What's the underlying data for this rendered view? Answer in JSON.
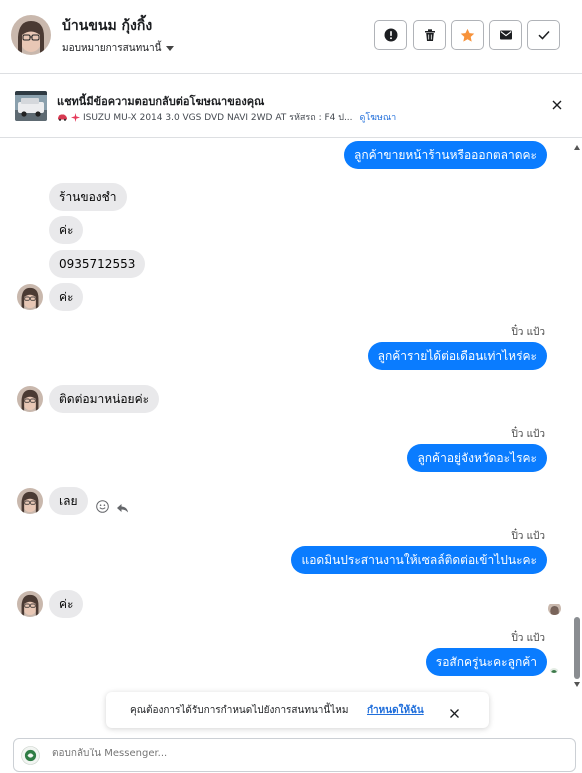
{
  "header": {
    "contact_name": "บ้านขนม กุ้งกิ้ง",
    "assign_label": "มอบหมายการสนทนานี้",
    "actions": [
      {
        "name": "mark-spam-button",
        "icon": "exclamation-icon"
      },
      {
        "name": "delete-button",
        "icon": "trash-icon"
      },
      {
        "name": "star-button",
        "icon": "star-icon"
      },
      {
        "name": "mark-unread-button",
        "icon": "envelope-icon"
      },
      {
        "name": "mark-done-button",
        "icon": "check-icon"
      }
    ],
    "star_color": "#f7923a"
  },
  "ad_banner": {
    "title": "แชทนี้มีข้อความตอบกลับต่อโฆษณาของคุณ",
    "subtitle": "ISUZU MU-X 2014 3.0 VGS DVD NAVI 2WD AT รหัสรถ : F4 ป...",
    "link_label": "ดูโฆษณา"
  },
  "messages": [
    {
      "dir": "out",
      "text": "ลูกค้าขายหน้าร้านหรือออกตลาดคะ"
    },
    {
      "dir": "in",
      "text": "ร้านของชำ"
    },
    {
      "dir": "in",
      "text": "ค่ะ"
    },
    {
      "dir": "in",
      "text": "0935712553"
    },
    {
      "dir": "in",
      "text": "ค่ะ"
    },
    {
      "dir": "out",
      "sender": "ปิ๋ว แป้ว",
      "text": "ลูกค้ารายได้ต่อเดือนเท่าไหร่คะ"
    },
    {
      "dir": "in",
      "text": "ติดต่อมาหน่อยค่ะ"
    },
    {
      "dir": "out",
      "sender": "ปิ๋ว แป้ว",
      "text": "ลูกค้าอยู่จังหวัดอะไรคะ"
    },
    {
      "dir": "in",
      "text": "เลย"
    },
    {
      "dir": "out",
      "sender": "ปิ๋ว แป้ว",
      "text": "แอดมินประสานงานให้เซลล์ติดต่อเข้าไปนะคะ"
    },
    {
      "dir": "in",
      "text": "ค่ะ"
    },
    {
      "dir": "out",
      "sender": "ปิ๋ว แป้ว",
      "text": "รอสักครู่นะคะลูกค้า"
    }
  ],
  "colors": {
    "outgoing_bubble": "#0a7cff",
    "incoming_bubble": "#e9e9eb",
    "link": "#216fdb"
  },
  "toast": {
    "text": "คุณต้องการได้รับการกำหนดไปยังการสนทนานี้ไหม",
    "link_label": "กำหนดให้ฉัน"
  },
  "composer": {
    "placeholder": "ตอบกลับใน Messenger..."
  }
}
